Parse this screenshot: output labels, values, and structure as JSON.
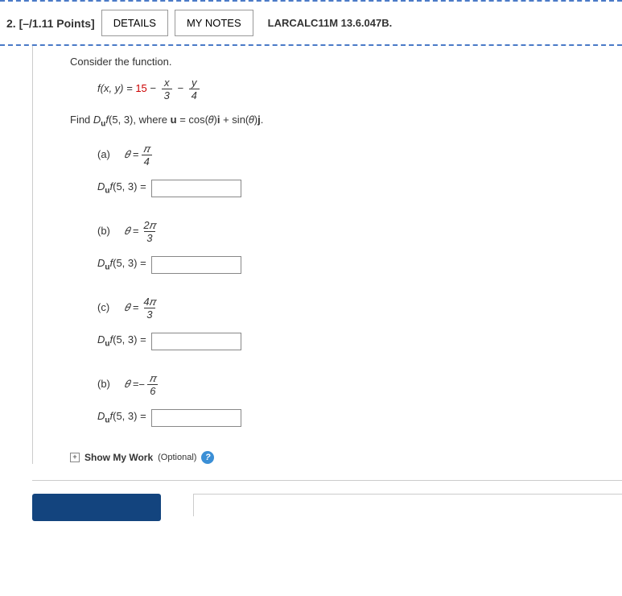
{
  "header": {
    "number": "2.",
    "points": "[–/1.11 Points]",
    "details_btn": "DETAILS",
    "notes_btn": "MY NOTES",
    "source": "LARCALC11M 13.6.047B."
  },
  "problem": {
    "consider": "Consider the function.",
    "func_lhs": "f(x, y) = ",
    "func_const": "15",
    "minus": " − ",
    "frac1_num": "x",
    "frac1_den": "3",
    "frac2_num": "y",
    "frac2_den": "4",
    "find_pre": "Find ",
    "duf": "D",
    "duf_sub": "u",
    "duf_f": "f",
    "point": "(5, 3)",
    "where": ", where ",
    "u": "u",
    "eq_cos": " = cos(𝜃)",
    "i": "i",
    "plus_sin": " + sin(𝜃)",
    "j": "j",
    "dot": "."
  },
  "parts": [
    {
      "label": "(a)",
      "theta": "𝜃 = ",
      "num": "𝜋",
      "den": "4",
      "neg": ""
    },
    {
      "label": "(b)",
      "theta": "𝜃 = ",
      "num": "2𝜋",
      "den": "3",
      "neg": ""
    },
    {
      "label": "(c)",
      "theta": "𝜃 = ",
      "num": "4𝜋",
      "den": "3",
      "neg": ""
    },
    {
      "label": "(b)",
      "theta": "𝜃 = ",
      "num": "𝜋",
      "den": "6",
      "neg": "− "
    }
  ],
  "answer_lhs": {
    "D": "D",
    "sub": "u",
    "f": "f",
    "pt": "(5, 3) ="
  },
  "smw": {
    "icon": "+",
    "label": "Show My Work",
    "optional": "(Optional)",
    "q": "?"
  }
}
